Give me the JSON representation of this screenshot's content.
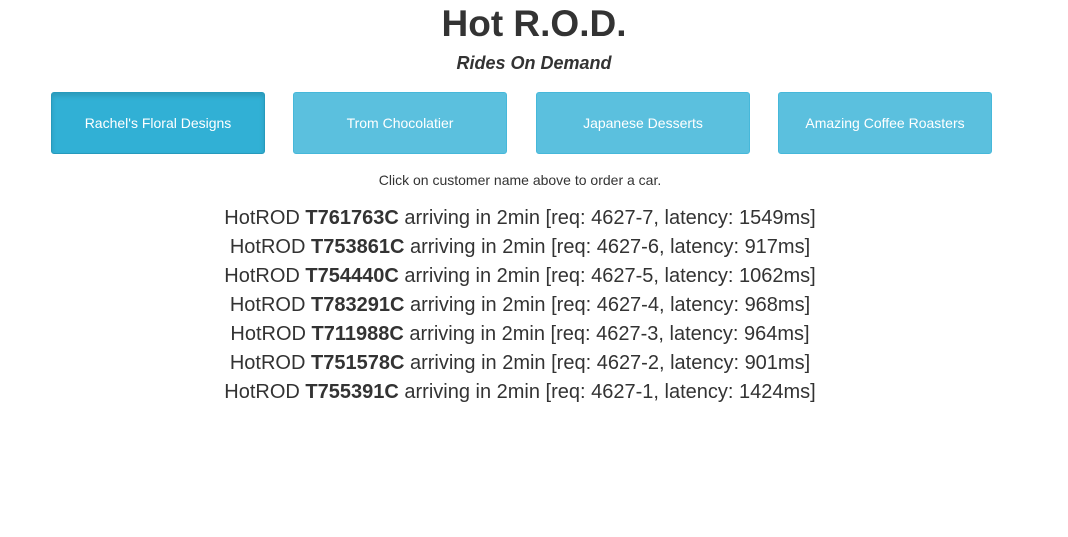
{
  "header": {
    "title": "Hot R.O.D.",
    "subtitle": "Rides On Demand"
  },
  "customers": [
    {
      "label": "Rachel's Floral Designs",
      "active": true
    },
    {
      "label": "Trom Chocolatier",
      "active": false
    },
    {
      "label": "Japanese Desserts",
      "active": false
    },
    {
      "label": "Amazing Coffee Roasters",
      "active": false
    }
  ],
  "hint": "Click on customer name above to order a car.",
  "rides": [
    {
      "prefix": "HotROD",
      "plate": "T761763C",
      "suffix": "arriving in 2min [req: 4627-7, latency: 1549ms]"
    },
    {
      "prefix": "HotROD",
      "plate": "T753861C",
      "suffix": "arriving in 2min [req: 4627-6, latency: 917ms]"
    },
    {
      "prefix": "HotROD",
      "plate": "T754440C",
      "suffix": "arriving in 2min [req: 4627-5, latency: 1062ms]"
    },
    {
      "prefix": "HotROD",
      "plate": "T783291C",
      "suffix": "arriving in 2min [req: 4627-4, latency: 968ms]"
    },
    {
      "prefix": "HotROD",
      "plate": "T711988C",
      "suffix": "arriving in 2min [req: 4627-3, latency: 964ms]"
    },
    {
      "prefix": "HotROD",
      "plate": "T751578C",
      "suffix": "arriving in 2min [req: 4627-2, latency: 901ms]"
    },
    {
      "prefix": "HotROD",
      "plate": "T755391C",
      "suffix": "arriving in 2min [req: 4627-1, latency: 1424ms]"
    }
  ],
  "colors": {
    "button": "#5bc0de",
    "button_active": "#31b0d5",
    "text": "#333333"
  }
}
